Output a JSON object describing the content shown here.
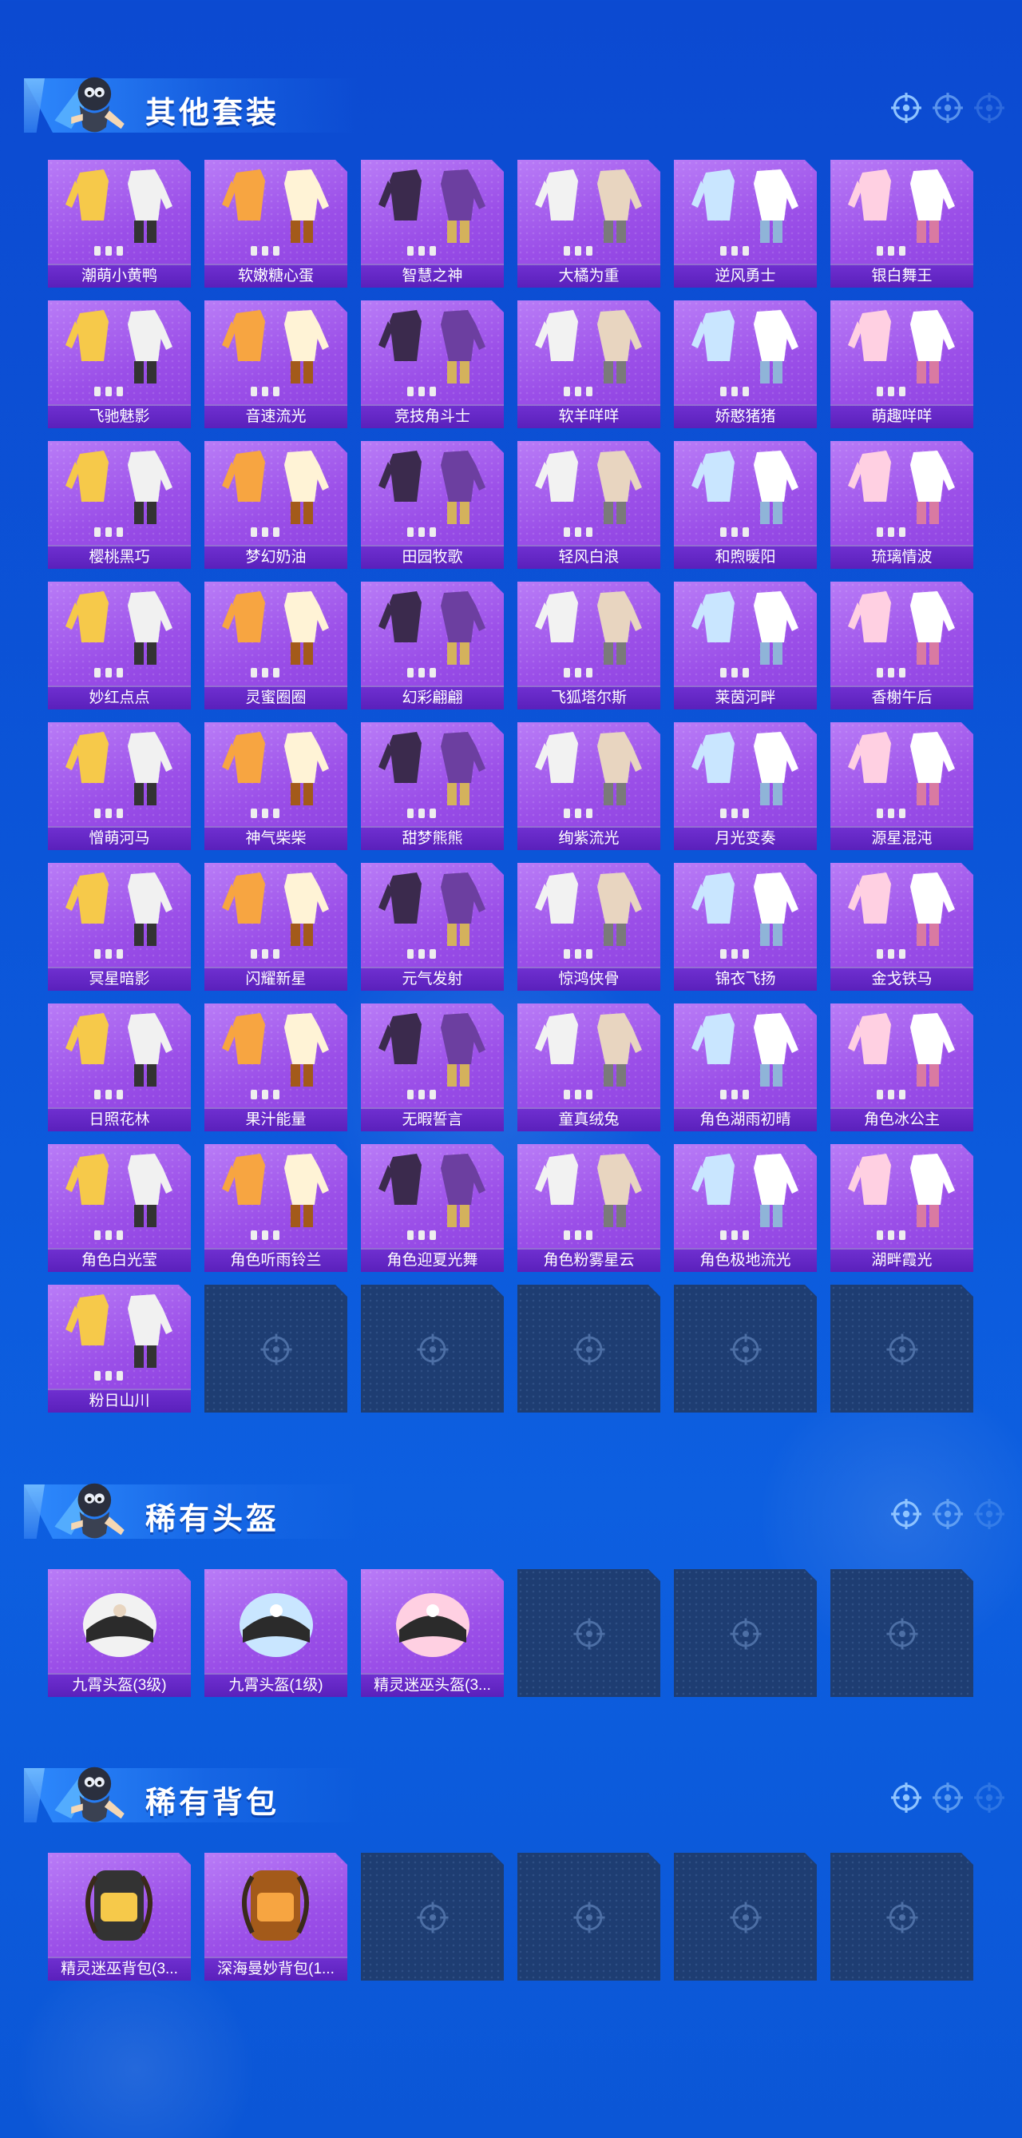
{
  "colors": {
    "page_bg": "#0c4ad1",
    "card_purple": "#9b4fe8",
    "label_purple": "#5a20bb",
    "empty_slot": "#1e3d72"
  },
  "sections": [
    {
      "title": "其他套装",
      "empty_slots": 5,
      "items": [
        {
          "label": "潮萌小黄鸭",
          "icon": "yellow-duck-outfit-icon"
        },
        {
          "label": "软嫩糖心蛋",
          "icon": "egg-outfit-icon"
        },
        {
          "label": "智慧之神",
          "icon": "dark-goddess-outfit-icon"
        },
        {
          "label": "大橘为重",
          "icon": "orange-outfit-icon"
        },
        {
          "label": "逆风勇士",
          "icon": "armor-outfit-icon"
        },
        {
          "label": "银白舞王",
          "icon": "silver-dancer-outfit-icon"
        },
        {
          "label": "飞驰魅影",
          "icon": "racer-outfit-icon"
        },
        {
          "label": "音速流光",
          "icon": "sonic-outfit-icon"
        },
        {
          "label": "竞技角斗士",
          "icon": "gladiator-outfit-icon"
        },
        {
          "label": "软羊咩咩",
          "icon": "sheep-outfit-icon"
        },
        {
          "label": "娇憨猪猪",
          "icon": "piggy-outfit-icon"
        },
        {
          "label": "萌趣咩咩",
          "icon": "cute-sheep-outfit-icon"
        },
        {
          "label": "樱桃黑巧",
          "icon": "cherry-choco-outfit-icon"
        },
        {
          "label": "梦幻奶油",
          "icon": "dream-cream-outfit-icon"
        },
        {
          "label": "田园牧歌",
          "icon": "pastoral-outfit-icon"
        },
        {
          "label": "轻风白浪",
          "icon": "breeze-outfit-icon"
        },
        {
          "label": "和煦暖阳",
          "icon": "warm-sun-outfit-icon"
        },
        {
          "label": "琉璃情波",
          "icon": "glass-wave-outfit-icon"
        },
        {
          "label": "妙红点点",
          "icon": "red-dots-outfit-icon"
        },
        {
          "label": "灵蜜圈圈",
          "icon": "honey-outfit-icon"
        },
        {
          "label": "幻彩翩翩",
          "icon": "rainbow-outfit-icon"
        },
        {
          "label": "飞狐塔尔斯",
          "icon": "fox-outfit-icon"
        },
        {
          "label": "莱茵河畔",
          "icon": "rhine-outfit-icon"
        },
        {
          "label": "香榭午后",
          "icon": "afternoon-outfit-icon"
        },
        {
          "label": "憎萌河马",
          "icon": "hippo-outfit-icon"
        },
        {
          "label": "神气柴柴",
          "icon": "shiba-outfit-icon"
        },
        {
          "label": "甜梦熊熊",
          "icon": "bear-outfit-icon"
        },
        {
          "label": "绚紫流光",
          "icon": "purple-light-outfit-icon"
        },
        {
          "label": "月光变奏",
          "icon": "moonlight-outfit-icon"
        },
        {
          "label": "源星混沌",
          "icon": "chaos-star-outfit-icon"
        },
        {
          "label": "冥星暗影",
          "icon": "dark-star-outfit-icon"
        },
        {
          "label": "闪耀新星",
          "icon": "new-star-outfit-icon"
        },
        {
          "label": "元气发射",
          "icon": "energy-outfit-icon"
        },
        {
          "label": "惊鸿侠骨",
          "icon": "hero-outfit-icon"
        },
        {
          "label": "锦衣飞扬",
          "icon": "brocade-outfit-icon"
        },
        {
          "label": "金戈铁马",
          "icon": "golden-warrior-outfit-icon"
        },
        {
          "label": "日照花林",
          "icon": "flower-forest-outfit-icon"
        },
        {
          "label": "果汁能量",
          "icon": "juice-outfit-icon"
        },
        {
          "label": "无暇誓言",
          "icon": "oath-outfit-icon"
        },
        {
          "label": "童真绒兔",
          "icon": "bunny-outfit-icon"
        },
        {
          "label": "角色湖雨初晴",
          "icon": "character-lake-rain-icon"
        },
        {
          "label": "角色冰公主",
          "icon": "character-ice-princess-icon"
        },
        {
          "label": "角色白光莹",
          "icon": "character-white-light-icon"
        },
        {
          "label": "角色听雨铃兰",
          "icon": "character-lily-icon"
        },
        {
          "label": "角色迎夏光舞",
          "icon": "character-summer-dance-icon"
        },
        {
          "label": "角色粉雾星云",
          "icon": "character-pink-nebula-icon"
        },
        {
          "label": "角色极地流光",
          "icon": "character-polar-light-icon"
        },
        {
          "label": "湖畔霞光",
          "icon": "lakeside-outfit-icon"
        },
        {
          "label": "粉日山川",
          "icon": "pink-mountain-outfit-icon"
        }
      ]
    },
    {
      "title": "稀有头盔",
      "empty_slots": 3,
      "items": [
        {
          "label": "九霄头盔(3级)",
          "icon": "level3-helmet-icon"
        },
        {
          "label": "九霄头盔(1级)",
          "icon": "level1-helmet-icon"
        },
        {
          "label": "精灵迷巫头盔(3...",
          "icon": "elf-helmet-icon"
        }
      ]
    },
    {
      "title": "稀有背包",
      "empty_slots": 4,
      "items": [
        {
          "label": "精灵迷巫背包(3...",
          "icon": "elf-backpack-icon"
        },
        {
          "label": "深海曼妙背包(1...",
          "icon": "deep-sea-backpack-icon"
        }
      ]
    }
  ]
}
